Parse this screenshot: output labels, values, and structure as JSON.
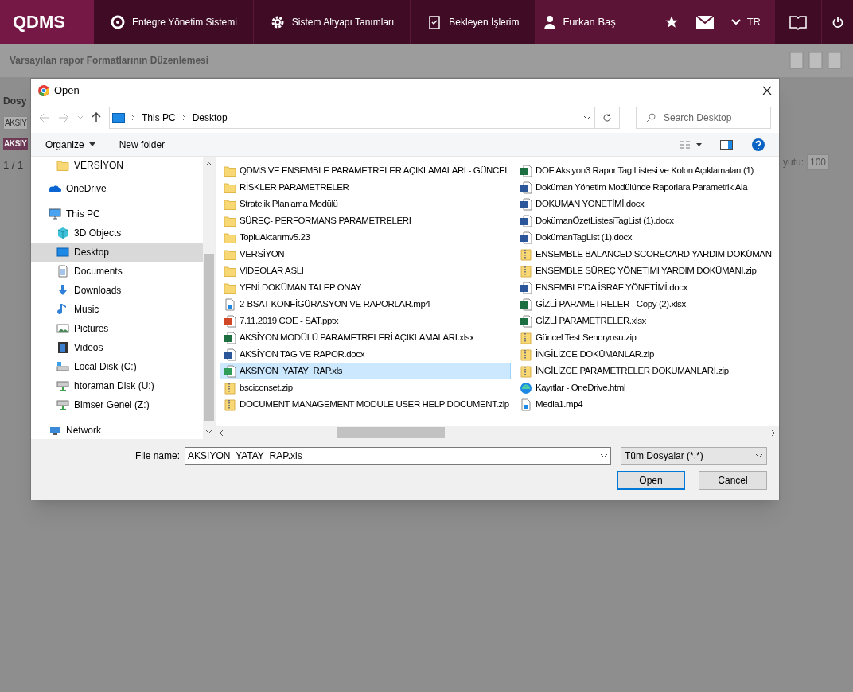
{
  "app_bar": {
    "logo": "QDMS",
    "menu": [
      {
        "label": "Entegre Yönetim Sistemi",
        "kind": "q"
      },
      {
        "label": "Sistem Altyapı Tanımları",
        "kind": "gear"
      },
      {
        "label": "Bekleyen İşlerim",
        "kind": "clipboard"
      }
    ],
    "user": "Furkan Baş",
    "language": "TR"
  },
  "page": {
    "title": "Varsayılan rapor Formatlarının Düzenlemesi",
    "section_label": "Dosy",
    "field_value": "AKSIY",
    "bar_label": "AKSIY",
    "pager": "1 / 1",
    "page_size_label": "yutu:",
    "page_size": "100"
  },
  "dialog": {
    "title": "Open",
    "breadcrumb": [
      "This PC",
      "Desktop"
    ],
    "search": {
      "placeholder": "Search Desktop"
    },
    "toolbar": [
      "Organize",
      "New folder"
    ],
    "quick_access": [
      {
        "label": "VERSİYON"
      }
    ],
    "nav": [
      {
        "label": "OneDrive",
        "kind": "cloud",
        "selected": false
      },
      {
        "label": "This PC",
        "kind": "pc",
        "selected": false,
        "children": [
          {
            "label": "3D Objects",
            "kind": "cube",
            "selected": false
          },
          {
            "label": "Desktop",
            "kind": "desktop",
            "selected": true
          },
          {
            "label": "Documents",
            "kind": "doc",
            "selected": false
          },
          {
            "label": "Downloads",
            "kind": "download",
            "selected": false
          },
          {
            "label": "Music",
            "kind": "music",
            "selected": false
          },
          {
            "label": "Pictures",
            "kind": "picture",
            "selected": false
          },
          {
            "label": "Videos",
            "kind": "video",
            "selected": false
          },
          {
            "label": "Local Disk (C:)",
            "kind": "disk",
            "selected": false
          },
          {
            "label": "htoraman Disk (U:)",
            "kind": "netdrive",
            "selected": false
          },
          {
            "label": "Bimser Genel (Z:)",
            "kind": "netdrive",
            "selected": false
          }
        ]
      },
      {
        "label": "Network",
        "kind": "network",
        "selected": false
      }
    ],
    "files": [
      {
        "name": "QDMS VE ENSEMBLE PARAMETRELER AÇIKLAMALARI - GÜNCEL",
        "kind": "folder",
        "selected": false
      },
      {
        "name": "RİSKLER PARAMETRELER",
        "kind": "folder",
        "selected": false
      },
      {
        "name": "Stratejik Planlama Modülü",
        "kind": "folder",
        "selected": false
      },
      {
        "name": "SÜREÇ- PERFORMANS PARAMETRELERİ",
        "kind": "folder",
        "selected": false
      },
      {
        "name": "TopluAktarımv5.23",
        "kind": "folder",
        "selected": false
      },
      {
        "name": "VERSİYON",
        "kind": "folder",
        "selected": false
      },
      {
        "name": "VİDEOLAR ASLI",
        "kind": "folder",
        "selected": false
      },
      {
        "name": "YENİ DOKÜMAN TALEP ONAY",
        "kind": "folder",
        "selected": false
      },
      {
        "name": "2-BSAT KONFİGÜRASYON VE RAPORLAR.mp4",
        "kind": "video",
        "selected": false
      },
      {
        "name": "7.11.2019 COE - SAT.pptx",
        "kind": "pptx",
        "selected": false
      },
      {
        "name": "AKSİYON MODÜLÜ PARAMETRELERİ AÇIKLAMALARI.xlsx",
        "kind": "xlsx",
        "selected": false
      },
      {
        "name": "AKSİYON TAG VE RAPOR.docx",
        "kind": "docx",
        "selected": false
      },
      {
        "name": "AKSIYON_YATAY_RAP.xls",
        "kind": "xls",
        "selected": true
      },
      {
        "name": "bsciconset.zip",
        "kind": "zip",
        "selected": false
      },
      {
        "name": "DOCUMENT MANAGEMENT MODULE USER HELP DOCUMENT.zip",
        "kind": "zip",
        "selected": false
      },
      {
        "name": "DOF Aksiyon3 Rapor Tag Listesi ve Kolon Açıklamaları (1)",
        "kind": "xlsx",
        "selected": false
      },
      {
        "name": "Doküman Yönetim Modülünde Raporlara Parametrik Ala",
        "kind": "docx",
        "selected": false
      },
      {
        "name": "DOKÜMAN YÖNETİMİ.docx",
        "kind": "docx",
        "selected": false
      },
      {
        "name": "DokümanÖzetListesiTagList (1).docx",
        "kind": "docx",
        "selected": false
      },
      {
        "name": "DokümanTagList (1).docx",
        "kind": "docx",
        "selected": false
      },
      {
        "name": "ENSEMBLE BALANCED SCORECARD YARDIM DOKÜMAN",
        "kind": "zip",
        "selected": false
      },
      {
        "name": "ENSEMBLE SÜREÇ YÖNETİMİ YARDIM DOKÜMANI.zip",
        "kind": "zip",
        "selected": false
      },
      {
        "name": "ENSEMBLE'DA İSRAF YÖNETİMİ.docx",
        "kind": "docx",
        "selected": false
      },
      {
        "name": "GİZLİ PARAMETRELER - Copy (2).xlsx",
        "kind": "xlsx",
        "selected": false
      },
      {
        "name": "GİZLİ PARAMETRELER.xlsx",
        "kind": "xlsx",
        "selected": false
      },
      {
        "name": "Güncel Test Senoryosu.zip",
        "kind": "zip",
        "selected": false
      },
      {
        "name": "İNGİLİZCE DOKÜMANLAR.zip",
        "kind": "zip",
        "selected": false
      },
      {
        "name": "İNGİLİZCE PARAMETRELER DOKÜMANLARI.zip",
        "kind": "zip",
        "selected": false
      },
      {
        "name": "Kayıtlar - OneDrive.html",
        "kind": "html",
        "selected": false
      },
      {
        "name": "Media1.mp4",
        "kind": "video",
        "selected": false
      }
    ],
    "file_name": {
      "label": "File name:",
      "value": "AKSIYON_YATAY_RAP.xls"
    },
    "file_type": "Tüm Dosyalar (*.*)",
    "buttons": [
      {
        "label": "Open",
        "default": true
      },
      {
        "label": "Cancel",
        "default": false
      }
    ]
  }
}
